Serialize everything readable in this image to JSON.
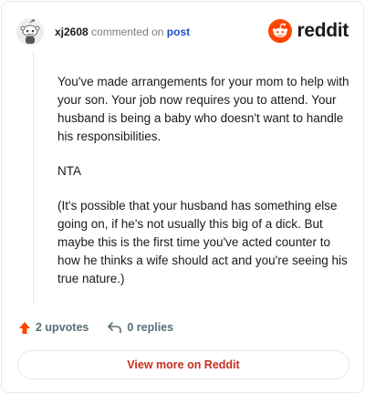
{
  "comment": {
    "author": "xj2608",
    "action_text": "commented on",
    "post_link": "post",
    "body": [
      "You've made arrangements for your mom to help with your son. Your job now requires you to attend. Your husband is being a baby who doesn't want to handle his responsibilities.",
      "NTA",
      "(It's possible that your husband has something else going on, if he's not usually this big of a dick. But maybe this is the first time you've acted counter to how he thinks a wife should act and you're seeing his true nature.)"
    ]
  },
  "brand": {
    "name": "reddit",
    "icon": "reddit-snoo-icon",
    "color": "#ff4500"
  },
  "actions": {
    "upvotes": "2 upvotes",
    "replies": "0 replies",
    "upvote_icon": "upvote-arrow-icon",
    "reply_icon": "reply-arrow-icon",
    "upvote_color": "#ff4500"
  },
  "footer": {
    "view_more": "View more on Reddit"
  }
}
